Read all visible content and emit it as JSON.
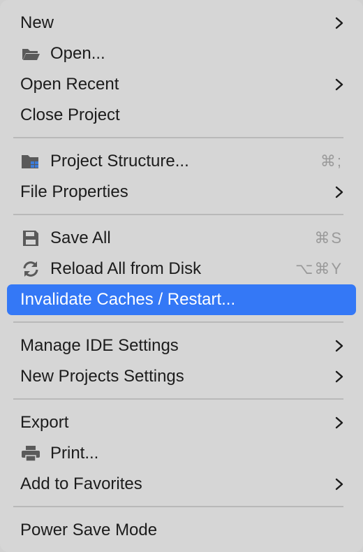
{
  "menu": {
    "items": [
      {
        "label": "New",
        "submenu": true
      },
      {
        "label": "Open...",
        "icon": "folder-open-icon"
      },
      {
        "label": "Open Recent",
        "submenu": true
      },
      {
        "label": "Close Project"
      },
      {
        "label": "Project Structure...",
        "icon": "project-structure-icon",
        "shortcut": "⌘;"
      },
      {
        "label": "File Properties",
        "submenu": true
      },
      {
        "label": "Save All",
        "icon": "save-icon",
        "shortcut": "⌘S"
      },
      {
        "label": "Reload All from Disk",
        "icon": "reload-icon",
        "shortcut": "⌥⌘Y"
      },
      {
        "label": "Invalidate Caches / Restart...",
        "selected": true
      },
      {
        "label": "Manage IDE Settings",
        "submenu": true
      },
      {
        "label": "New Projects Settings",
        "submenu": true
      },
      {
        "label": "Export",
        "submenu": true
      },
      {
        "label": "Print...",
        "icon": "printer-icon"
      },
      {
        "label": "Add to Favorites",
        "submenu": true
      },
      {
        "label": "Power Save Mode"
      }
    ]
  },
  "colors": {
    "menu_background": "#d6d6d6",
    "selected_background": "#3478f6",
    "selected_text": "#ffffff",
    "text": "#1c1c1c",
    "shortcut_text": "#9a9a9a",
    "separator": "#b9b9b9",
    "icon": "#5a5a5a",
    "icon_accent": "#3c7bd8"
  }
}
